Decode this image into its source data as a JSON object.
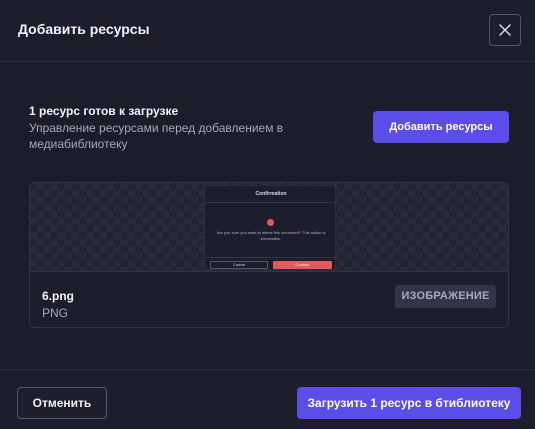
{
  "dialog": {
    "title": "Добавить ресурсы",
    "close_icon": "close-icon"
  },
  "summary": {
    "title": "1 ресурс готов к загрузке",
    "description": "Управление ресурсами перед добавлением в медиабиблиотеку",
    "add_button_label": "Добавить ресурсы"
  },
  "file": {
    "name": "6.png",
    "type": "PNG",
    "badge": "ИЗОБРАЖЕНИЕ",
    "preview": {
      "title": "Confirmation",
      "alert_icon": "alert-icon",
      "message": "Are you sure you want to delete this document? This action is irreversible.",
      "cancel_label": "Cancel",
      "confirm_label": "Confirm"
    }
  },
  "footer": {
    "cancel_label": "Отменить",
    "upload_label": "Загрузить 1 ресурс в бтиблиотеку"
  },
  "colors": {
    "accent": "#5a4de9",
    "background": "#1c1c2a",
    "danger": "#e25a5a"
  }
}
